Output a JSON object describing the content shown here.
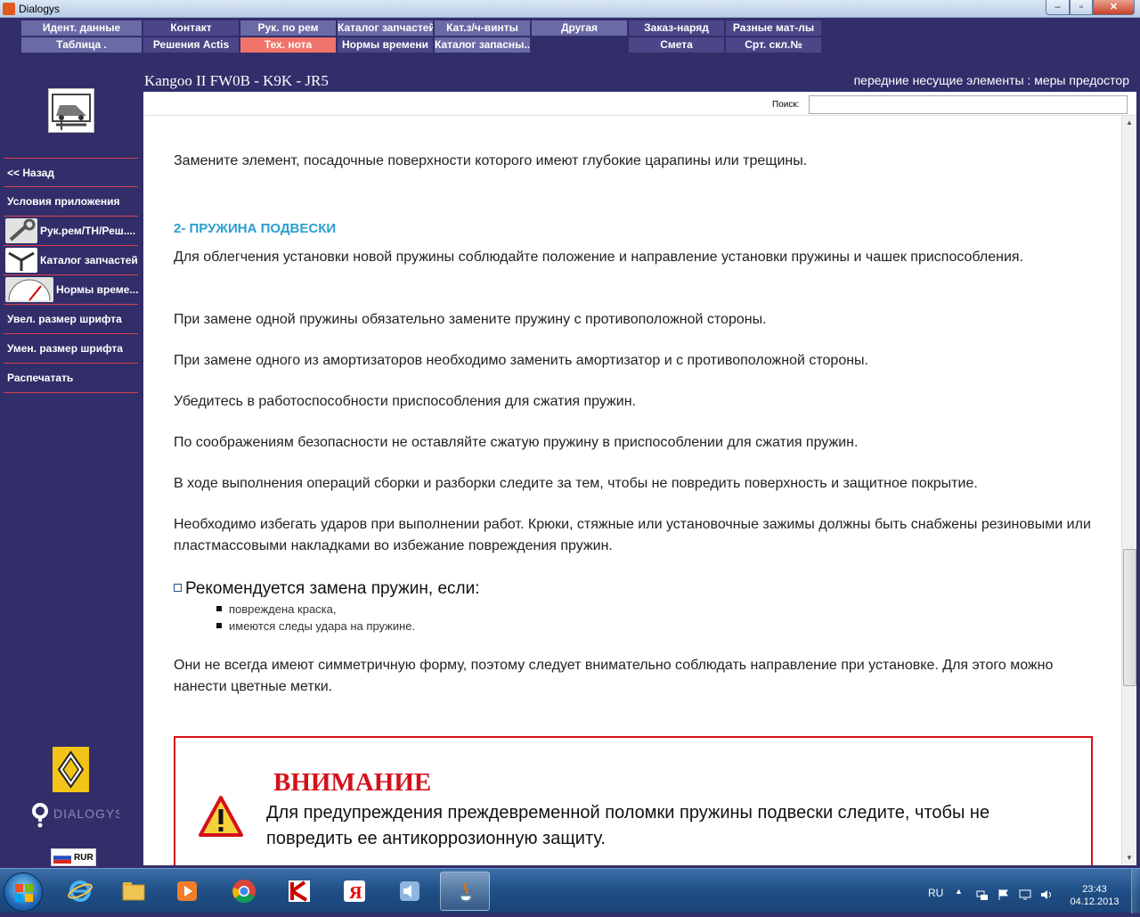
{
  "window": {
    "title": "Dialogys"
  },
  "topmenu": {
    "row1": [
      "Идент. данные",
      "Контакт",
      "Рук. по рем",
      "Каталог запчастей",
      "Кат.з/ч-винты",
      "Другая",
      "Заказ-наряд",
      "Разные мат-лы"
    ],
    "row2": [
      "Таблица .",
      "Решения Actis",
      "Тех. нота",
      "Нормы времени",
      "Каталог запасны...",
      "Смета",
      "Срт. скл.№"
    ]
  },
  "header": {
    "vehicle": "Kangoo II FW0B - K9K - JR5",
    "section": "передние несущие элементы : меры предостор"
  },
  "sidebar": {
    "items": [
      "<< Назад",
      "Условия приложения",
      "Рук.рем/ТН/Реш....",
      "Каталог запчастей",
      "Нормы време...",
      "Увел. размер шрифта",
      "Умен. размер шрифта",
      "Распечатать"
    ]
  },
  "search": {
    "label": "Поиск:",
    "value": ""
  },
  "document": {
    "p0": "Замените элемент, посадочные поверхности которого имеют глубокие царапины или трещины.",
    "heading": "2- ПРУЖИНА ПОДВЕСКИ",
    "p1": "Для облегчения установки новой пружины соблюдайте положение и направление установки пружины и чашек приспособления.",
    "p2": "При замене одной пружины обязательно замените пружину с противоположной стороны.",
    "p3": "При замене одного из амортизаторов необходимо заменить амортизатор и с противоположной стороны.",
    "p4": "Убедитесь в работоспособности приспособления для сжатия пружин.",
    "p5": "По соображениям безопасности не оставляйте сжатую пружину в приспособлении для сжатия пружин.",
    "p6": "В ходе выполнения операций сборки и разборки следите за тем, чтобы не повредить поверхность и защитное покрытие.",
    "p7": "Необходимо избегать ударов при выполнении работ. Крюки, стяжные или установочные зажимы должны быть снабжены резиновыми или пластмассовыми накладками во избежание повреждения пружин.",
    "rec_head": "Рекомендуется замена пружин, если:",
    "rec_items": [
      "повреждена краска,",
      "имеются следы удара на пружине."
    ],
    "p8": "Они не всегда имеют симметричную форму, поэтому следует внимательно соблюдать направление при установке. Для этого можно нанести цветные метки.",
    "warn_title": "ВНИМАНИЕ",
    "warn_text": "Для предупреждения преждевременной поломки пружины подвески следите, чтобы не повредить ее антикоррозионную защиту."
  },
  "branding": {
    "dialogys": "DIALOGYS",
    "lang": "RUR"
  },
  "taskbar": {
    "lang": "RU",
    "time": "23:43",
    "date": "04.12.2013"
  },
  "colors": {
    "accent": "#2a9fd2",
    "warning": "#d4111b",
    "background": "#322e6a"
  }
}
